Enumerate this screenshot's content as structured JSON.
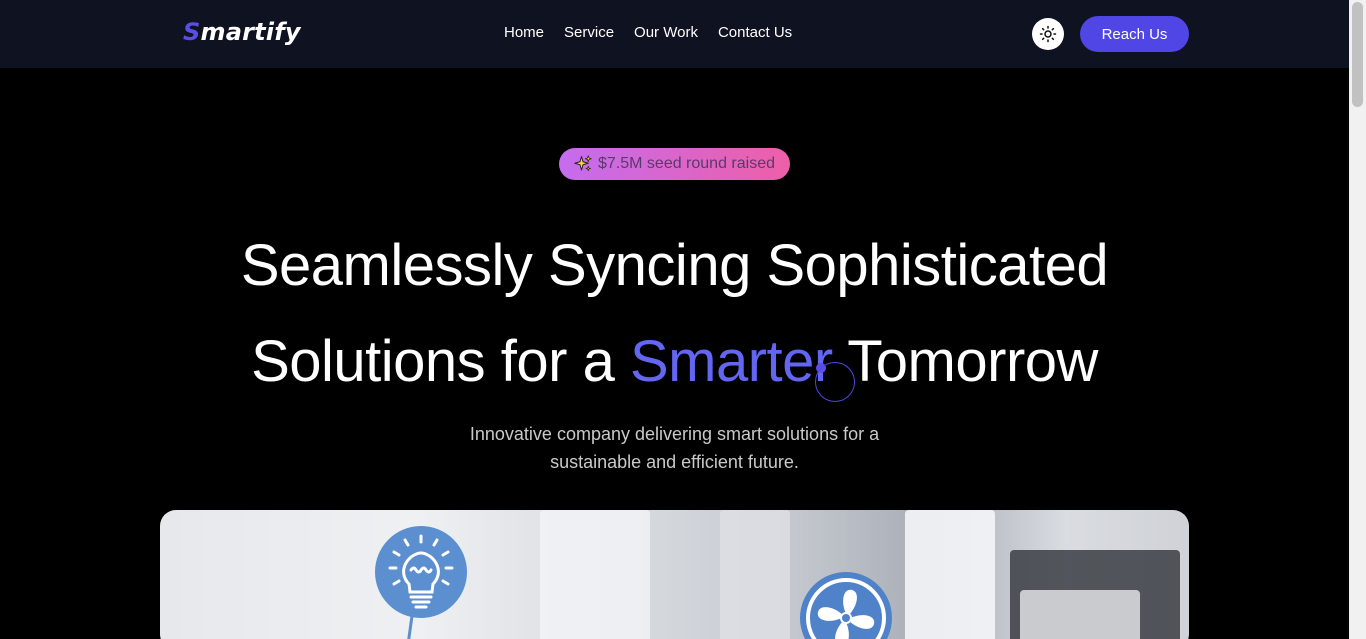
{
  "brand": {
    "first_letter": "S",
    "rest": "martify"
  },
  "nav": {
    "links": [
      {
        "label": "Home"
      },
      {
        "label": "Service"
      },
      {
        "label": "Our Work"
      },
      {
        "label": "Contact Us"
      }
    ],
    "theme_icon": "sun-icon",
    "cta_label": "Reach Us"
  },
  "hero": {
    "badge": {
      "icon": "sparkle-icon",
      "text": "$7.5M seed round raised"
    },
    "title_line1": "Seamlessly Syncing Sophisticated",
    "title_line2_prefix": "Solutions for a ",
    "title_line2_accent": "Smarter",
    "title_line2_suffix": " Tomorrow",
    "subtitle_line1": "Innovative company delivering smart solutions for a",
    "subtitle_line2": "sustainable and efficient future."
  },
  "image_icons": [
    "lightbulb-icon",
    "fan-icon"
  ],
  "colors": {
    "accent": "#4f46e5",
    "navbar_bg": "#0f1220",
    "badge_from": "#c56cf0",
    "badge_to": "#ee5fa8"
  }
}
